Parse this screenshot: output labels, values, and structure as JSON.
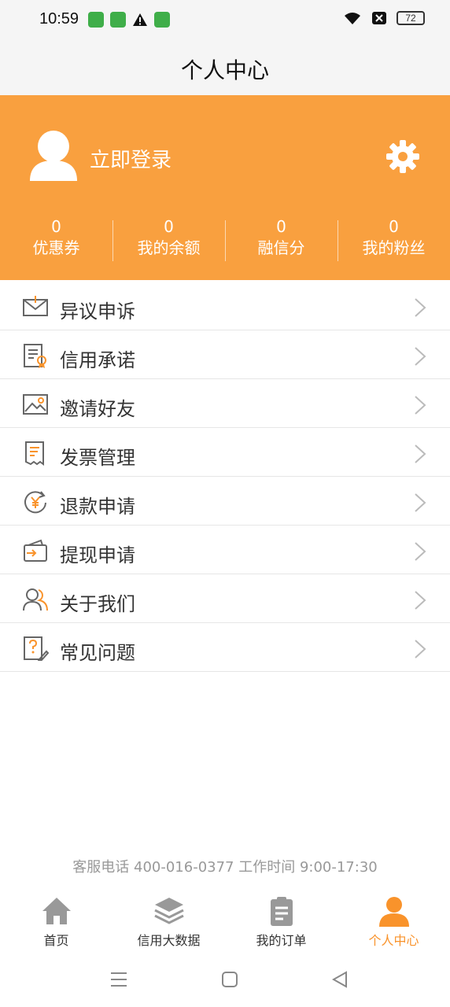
{
  "status_bar": {
    "time": "10:59",
    "battery": "72"
  },
  "header": {
    "title": "个人中心"
  },
  "profile": {
    "login_label": "立即登录"
  },
  "stats": [
    {
      "value": "0",
      "label": "优惠券"
    },
    {
      "value": "0",
      "label": "我的余额"
    },
    {
      "value": "0",
      "label": "融信分"
    },
    {
      "value": "0",
      "label": "我的粉丝"
    }
  ],
  "menu": [
    {
      "label": "异议申诉",
      "icon": "envelope-icon"
    },
    {
      "label": "信用承诺",
      "icon": "certificate-icon"
    },
    {
      "label": "邀请好友",
      "icon": "image-icon"
    },
    {
      "label": "发票管理",
      "icon": "receipt-icon"
    },
    {
      "label": "退款申请",
      "icon": "refund-icon"
    },
    {
      "label": "提现申请",
      "icon": "wallet-icon"
    },
    {
      "label": "关于我们",
      "icon": "users-icon"
    },
    {
      "label": "常见问题",
      "icon": "question-icon"
    }
  ],
  "footer": {
    "hotline": "客服电话  400-016-0377  工作时间 9:00-17:30"
  },
  "tabs": [
    {
      "label": "首页",
      "icon": "home-icon"
    },
    {
      "label": "信用大数据",
      "icon": "layers-icon"
    },
    {
      "label": "我的订单",
      "icon": "clipboard-icon"
    },
    {
      "label": "个人中心",
      "icon": "person-icon",
      "active": true
    }
  ],
  "colors": {
    "accent": "#f9a03f",
    "tab_active": "#f9932b"
  }
}
